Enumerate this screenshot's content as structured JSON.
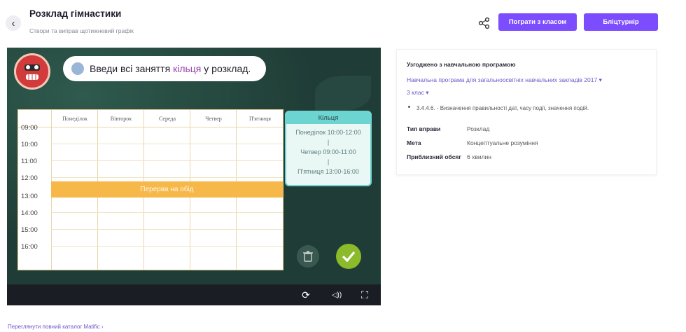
{
  "header": {
    "back_label": "‹",
    "title": "Розклад гімнастики",
    "subtitle": "Створи та виправ щотижневий графік",
    "share_icon": "share-icon",
    "play_class_label": "Пограти з класом",
    "tournament_label": "Бліцтурнір"
  },
  "game": {
    "prompt_prefix": "Введи всі заняття ",
    "prompt_highlight": "кільця",
    "prompt_suffix": " у розклад.",
    "days": [
      "Понеділок",
      "Вівторок",
      "Середа",
      "Четвер",
      "П'ятниця"
    ],
    "times": [
      "09:00",
      "10:00",
      "11:00",
      "12:00",
      "13:00",
      "14:00",
      "15:00",
      "16:00"
    ],
    "lunch_label": "Перерва на обід",
    "card": {
      "title": "Кільця",
      "lines": [
        "Понеділок 10:00-12:00",
        "|",
        "Четвер 09:00-11:00",
        "|",
        "П'ятниця 13:00-16:00"
      ]
    },
    "controls": {
      "refresh_icon": "⟳",
      "sound_icon": "◁))",
      "fullscreen_icon": "⛶"
    },
    "colors": {
      "lunch": "#f7b84a",
      "card_accent": "#6cd5d1",
      "check": "#8bba2a"
    }
  },
  "info": {
    "heading": "Узгоджено з навчальною програмою",
    "program_link": "Навчальна програма для загальноосвітніх навчальних закладів 2017 ▾",
    "grade_link": "3 клас ▾",
    "item": "3.4.4.6. - Визначення правильності дат, часу події, значення подій.",
    "rows": [
      {
        "label": "Тип вправи",
        "value": "Розклад"
      },
      {
        "label": "Мета",
        "value": "Концептуальне розуміння"
      },
      {
        "label": "Приблизний обсяг",
        "value": "6 хвилин"
      }
    ]
  },
  "footer": {
    "catalog_link": "Переглянути повний каталог Matific ›"
  }
}
